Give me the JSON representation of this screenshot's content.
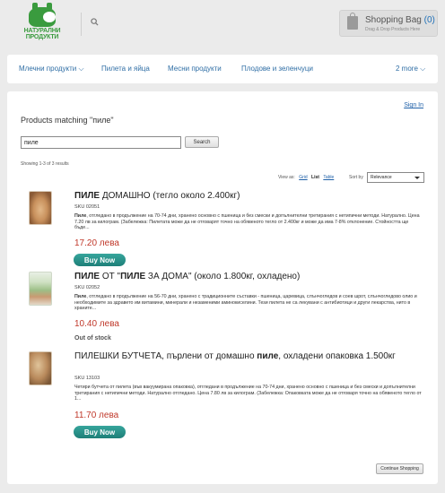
{
  "header": {
    "logo_text_line1": "НАТУРАЛНИ",
    "logo_text_line2": "ПРОДУКТИ",
    "search_icon": "search-icon",
    "bag_title": "Shopping Bag",
    "bag_count": "(0)",
    "bag_subtitle": "Drag & Drop Products Here",
    "bag_icon": "shopping-bag-icon"
  },
  "nav": {
    "items": [
      {
        "label": "Млечни продукти ⌵"
      },
      {
        "label": "Пилета и яйца"
      },
      {
        "label": "Месни продукти"
      },
      {
        "label": "Плодове и зеленчуци"
      }
    ],
    "more_label": "2 more ⌵"
  },
  "main": {
    "signin": "Sign In",
    "results_title": "Products matching \"пиле\"",
    "search_value": "пиле",
    "search_button": "Search",
    "showing": "Showing 1-3 of 3 results",
    "view_as_label": "View as:",
    "view_options": [
      "Grid",
      "List",
      "Table"
    ],
    "active_view": "List",
    "sort_by_label": "Sort by",
    "sort_value": "Relevance",
    "continue_button": "Continue Shopping"
  },
  "products": [
    {
      "title_bold": "ПИЛЕ",
      "title_rest": " ДОМАШНО (тегло около 2.400кг)",
      "sku": "SKU 02051",
      "desc_bold": "Пиле",
      "desc_rest": ", отгледано в продължение на 70-74 дни, хранено основно с пшеница и без смески и допълнителни третирания с нетипични методи. Натурално. Цена 7.20 лв за килограм. (Забележка: Пилетата може да не отговарят точно на обявеното тегло от 2.400кг и може да има 7-8% отклонение. Стойността ще бъде...",
      "price": "17.20 лева",
      "buy_label": "Buy Now"
    },
    {
      "title_bold": "ПИЛЕ",
      "title_mid": " ОТ \"",
      "title_bold2": "ПИЛЕ",
      "title_rest": " ЗА ДОМА\" (около 1.800кг, охладено)",
      "sku": "SKU 02052",
      "desc_bold": "Пиле",
      "desc_rest": ", отгледано в продължение на 56-70 дни, хранено с традиционните съставки - пшеница, царевица, слънчогледов и соев шрот, слънчогледово олио и необходимите за здравето им витамини, минерали и незаменими аминокиселини. Тези пилета не са лекувани с антибиотици и други лекарства, нито в храните...",
      "price": "10.40 лева",
      "stock_status": "Out of stock"
    },
    {
      "title_pre": "ПИЛЕШКИ БУТЧЕТА, пърлени от домашно ",
      "title_bold": "пиле",
      "title_rest": ", охладени опаковка 1.500кг",
      "sku": "SKU 13103",
      "desc_rest": "Четири бутчета от пилета (във вакуумирана опаковка), отгледани в продължение на 70-74 дни, хранено основно с пшеница и без смески и допълнителни третирания с нетипични методи. Натурално отгледано. Цена 7.80 лв за килограм. (Забележка: Опаковката може да не отговаря точно на обявеното тегло от 1...",
      "price": "11.70 лева",
      "buy_label": "Buy Now"
    }
  ]
}
